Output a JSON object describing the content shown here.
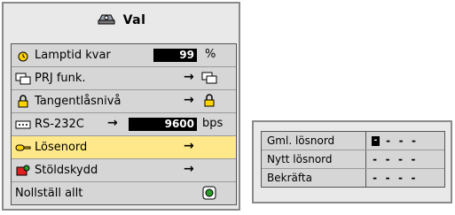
{
  "menu": {
    "title": "Val",
    "items": [
      {
        "label": "Lamptid kvar",
        "value": "99",
        "unit": "%",
        "icon": "lamp-timer-icon"
      },
      {
        "label": "PRJ funk.",
        "arrow": "→",
        "icon": "projector-screen-icon"
      },
      {
        "label": "Tangentlåsnivå",
        "arrow": "→",
        "icon": "padlock-icon"
      },
      {
        "label": "RS-232C",
        "arrow": "→",
        "value": "9600",
        "unit": "bps",
        "icon": "serial-port-icon"
      },
      {
        "label": "Lösenord",
        "arrow": "→",
        "icon": "key-icon",
        "selected": true
      },
      {
        "label": "Stöldskydd",
        "arrow": "→",
        "icon": "anti-theft-icon"
      },
      {
        "label": "Nollställ allt",
        "icon": "reset-icon"
      }
    ]
  },
  "password_panel": {
    "rows": [
      {
        "label": "Gml. lösnord",
        "value": "- - -"
      },
      {
        "label": "Nytt lösnord",
        "value": "- - - -"
      },
      {
        "label": "Bekräfta",
        "value": "- - - -"
      }
    ],
    "cursor": "-"
  },
  "colors": {
    "selected_row": "#ffe88a",
    "panel": "#e9e9e9",
    "list": "#d6d6d6"
  }
}
